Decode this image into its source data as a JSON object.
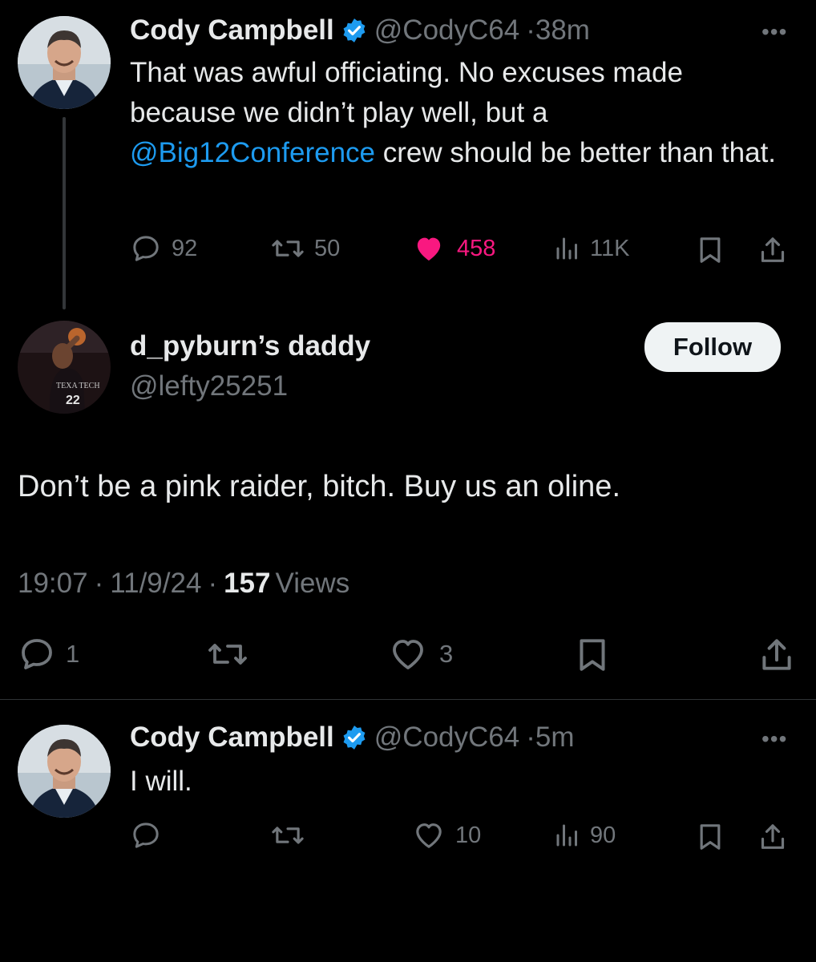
{
  "tweet1": {
    "name": "Cody Campbell",
    "handle": "@CodyC64",
    "sep": "·",
    "time": "38m",
    "text_before": "That was awful officiating.  No excuses made because we didn’t play well, but a ",
    "mention": "@Big12Conference",
    "text_after": " crew should be better than that.",
    "replies": "92",
    "retweets": "50",
    "likes": "458",
    "views": "11K",
    "more": "•••",
    "colors": {
      "like_active": "#f91880",
      "link": "#1d9bf0",
      "verified": "#1d9bf0"
    }
  },
  "main": {
    "name": "d_pyburn’s daddy",
    "handle": "@lefty25251",
    "follow_label": "Follow",
    "text": "Don’t be a pink raider, bitch. Buy us an oline.",
    "time": "19:07",
    "sep1": "·",
    "date": "11/9/24",
    "sep2": "·",
    "views_count": "157",
    "views_label": "Views",
    "replies": "1",
    "likes": "3",
    "avatar_jersey": "22",
    "avatar_text": "TEXA TECH"
  },
  "tweet2": {
    "name": "Cody Campbell",
    "handle": "@CodyC64",
    "sep": "·",
    "time": "5m",
    "text": "I will.",
    "likes": "10",
    "views": "90",
    "more": "•••"
  }
}
